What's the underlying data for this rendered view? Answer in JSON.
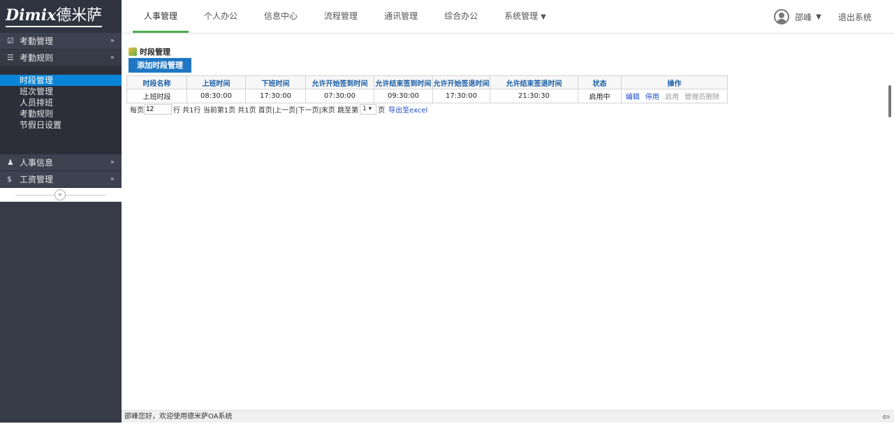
{
  "logo": {
    "latin": "Dimix",
    "cn": "德米萨"
  },
  "sidebar": {
    "groups": [
      {
        "label": "考勤管理",
        "arrow": "»",
        "icon": "checkbox-icon"
      },
      {
        "label": "考勤规则",
        "arrow": "«",
        "icon": "list-icon",
        "open": true
      },
      {
        "label": "人事信息",
        "arrow": "»",
        "icon": "person-icon"
      },
      {
        "label": "工资管理",
        "arrow": "»",
        "icon": "dollar-icon"
      }
    ],
    "subitems": [
      "时段管理",
      "班次管理",
      "人员排班",
      "考勤规则",
      "节假日设置"
    ],
    "collapse_glyph": "«"
  },
  "topnav": {
    "tabs": [
      "人事管理",
      "个人办公",
      "信息中心",
      "流程管理",
      "通讯管理",
      "综合办公",
      "系统管理"
    ],
    "active_index": 0,
    "dropdown_caret": "▼"
  },
  "user": {
    "name": "邵峰",
    "caret": "▼",
    "logout": "退出系统"
  },
  "page": {
    "title": "时段管理",
    "add_button": "添加时段管理",
    "headers": [
      "时段名称",
      "上班时间",
      "下班时间",
      "允许开始签到时间",
      "允许结束签到时间",
      "允许开始签退时间",
      "允许结束签退时间",
      "状态",
      "操作"
    ],
    "rows": [
      {
        "name": "上班时段",
        "on": "08:30:00",
        "off": "17:30:00",
        "sign_in_start": "07:30:00",
        "sign_in_end": "09:30:00",
        "sign_out_start": "17:30:00",
        "sign_out_end": "21:30:30",
        "status": "启用中"
      }
    ],
    "ops": {
      "edit": "编辑",
      "disable": "停用",
      "enable": "启用",
      "admin_delete": "管理员删除"
    }
  },
  "pager": {
    "per_page_label": "每页",
    "per_page_value": "12",
    "rest": "行 共1行  当前第1页  共1页  首页|上一页|下一页|末页  跳至第",
    "page_select": "1 ▾",
    "page_suffix": "页",
    "export": "导出至excel"
  },
  "footer": {
    "text": "邵峰您好，欢迎使用德米萨OA系统",
    "back_icon": "⇦"
  }
}
